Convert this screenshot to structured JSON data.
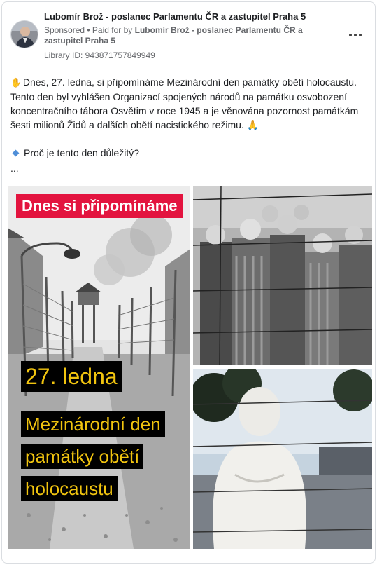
{
  "header": {
    "page_name": "Lubomír Brož - poslanec Parlamentu ČR a zastupitel Praha 5",
    "sponsored_label": "Sponsored",
    "paid_for_prefix": " • Paid for by ",
    "paid_for_name": "Lubomír Brož - poslanec Parlamentu ČR a zastupitel Praha 5",
    "library_id": "Library ID: 943871757849949"
  },
  "post": {
    "paragraph1": "Dnes, 27. ledna, si připomínáme Mezinárodní den památky obětí holocaustu. Tento den byl vyhlášen Organizací spojených národů na památku osvobození koncentračního tábora Osvětim v roce 1945 a je věnována pozornost památkám šesti milionů Židů a dalších obětí nacistického režimu.",
    "paragraph2": "Proč je tento den důležitý?",
    "ellipsis": "..."
  },
  "image_left": {
    "banner": "Dnes si připomínáme",
    "date": "27. ledna",
    "line1": "Mezinárodní den",
    "line2": "památky obětí",
    "line3": "holocaustu"
  },
  "colors": {
    "banner_red": "#e3143f",
    "caption_yellow": "#f1c40f",
    "caption_bg": "#000000",
    "meta_gray": "#65676b"
  },
  "icons": {
    "more": "more-horizontal-icon",
    "hand": "raised-hand-icon",
    "pray": "folded-hands-icon",
    "bullet": "blue-diamond-icon"
  }
}
